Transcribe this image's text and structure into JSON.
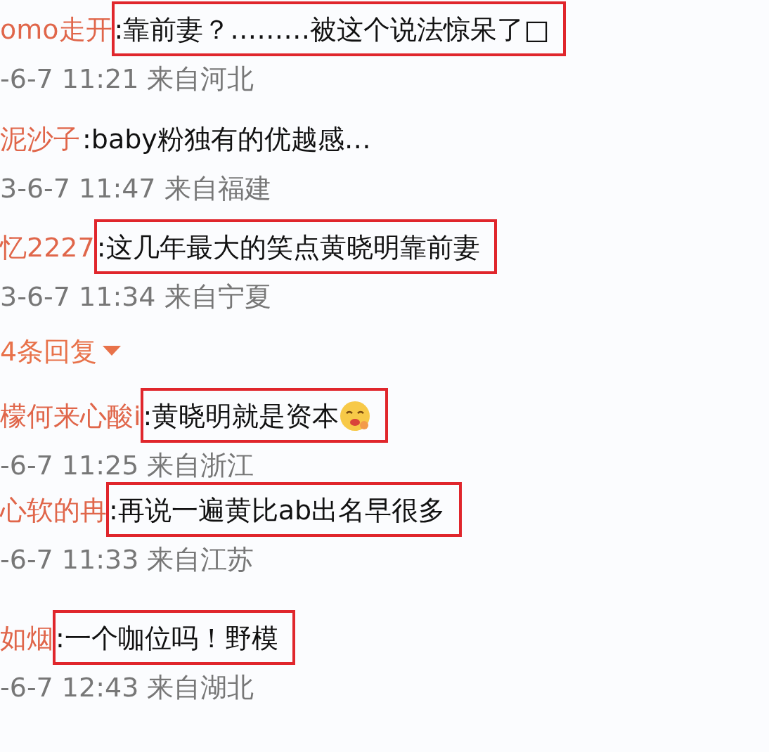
{
  "comments": [
    {
      "kind": "comment",
      "user": "omo走开",
      "text": ":靠前妻？………被这个说法惊呆了□",
      "emoji": false,
      "meta": "-6-7 11:21 来自河北",
      "highlighted": true
    },
    {
      "kind": "comment",
      "user": "泥沙子",
      "text": ":baby粉独有的优越感…",
      "emoji": false,
      "meta": "3-6-7 11:47 来自福建",
      "highlighted": false
    },
    {
      "kind": "comment",
      "user": "忆2227",
      "text": ":这几年最大的笑点黄晓明靠前妻",
      "emoji": false,
      "meta": "3-6-7 11:34 来自宁夏",
      "highlighted": true
    },
    {
      "kind": "replies",
      "label": "4条回复"
    },
    {
      "kind": "comment",
      "user": "檬何来心酸i",
      "text": ":黄晓明就是资本",
      "emoji": true,
      "meta": "-6-7 11:25 来自浙江",
      "highlighted": true
    },
    {
      "kind": "comment",
      "user": "心软的冉",
      "text": ":再说一遍黄比ab出名早很多",
      "emoji": false,
      "meta": "-6-7 11:33 来自江苏",
      "highlighted": true
    },
    {
      "kind": "comment",
      "user": "如烟",
      "text": ":一个咖位吗！野模",
      "emoji": false,
      "meta": "-6-7 12:43 来自湖北",
      "highlighted": true
    }
  ]
}
